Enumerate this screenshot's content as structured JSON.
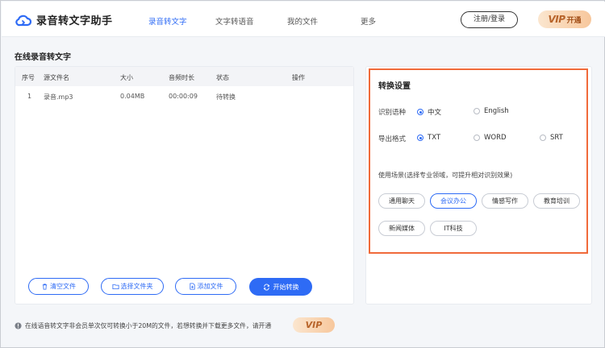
{
  "header": {
    "app_name": "录音转文字助手",
    "nav": [
      "录音转文字",
      "文字转语音",
      "我的文件",
      "更多"
    ],
    "login_label": "注册/登录",
    "vip_label": "VIP",
    "vip_open_label": "开通"
  },
  "page_title": "在线录音转文字",
  "file_table": {
    "columns": [
      "序号",
      "源文件名",
      "大小",
      "音频时长",
      "状态",
      "操作"
    ],
    "rows": [
      {
        "index": "1",
        "name": "录音.mp3",
        "size": "0.04MB",
        "duration": "00:00:09",
        "status": "待转换",
        "action": ""
      }
    ]
  },
  "actions": {
    "clear": "清空文件",
    "select_folder": "选择文件夹",
    "add_file": "添加文件",
    "start": "开始转换"
  },
  "settings": {
    "title": "转换设置",
    "language_label": "识别语种",
    "languages": [
      {
        "label": "中文",
        "checked": true
      },
      {
        "label": "English",
        "checked": false
      }
    ],
    "format_label": "导出格式",
    "formats": [
      {
        "label": "TXT",
        "checked": true
      },
      {
        "label": "WORD",
        "checked": false
      },
      {
        "label": "SRT",
        "checked": false
      }
    ],
    "scene_label": "使用场景(选择专业领域，可提升相对识别效果)",
    "scenes": [
      {
        "label": "通用聊天",
        "active": false
      },
      {
        "label": "会议办公",
        "active": true
      },
      {
        "label": "情感写作",
        "active": false
      },
      {
        "label": "教育培训",
        "active": false
      },
      {
        "label": "新闻媒体",
        "active": false
      },
      {
        "label": "IT科技",
        "active": false
      }
    ]
  },
  "notice": {
    "text": "在线语音转文字非会员单次仅可转换小于20M的文件，若想转换并下载更多文件，请开通",
    "vip_label": "VIP"
  },
  "colors": {
    "accent": "#2e6bf5",
    "highlight_border": "#f06a3a",
    "vip_text": "#b8642a"
  }
}
